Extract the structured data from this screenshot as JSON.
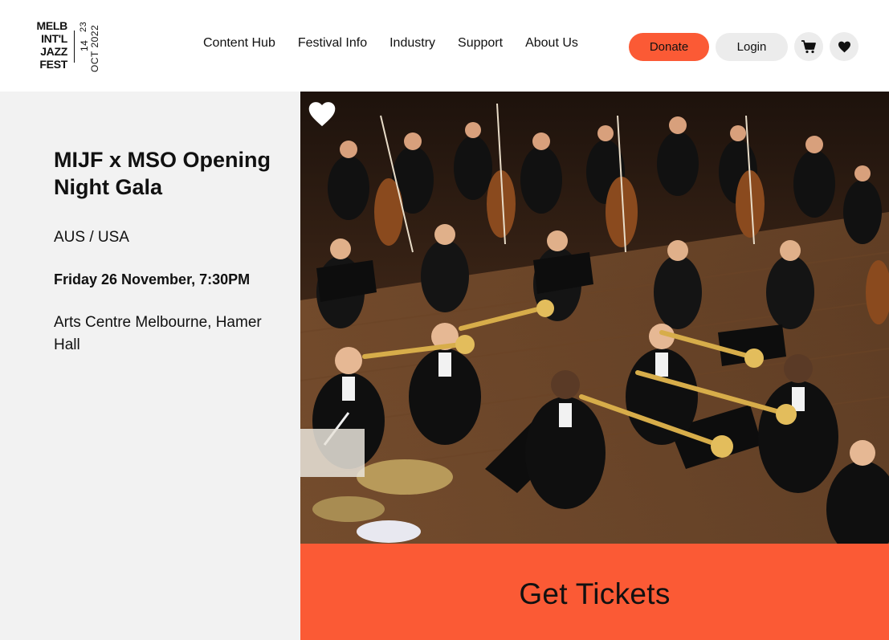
{
  "logo": {
    "words": [
      "MELB",
      "INT'L",
      "JAZZ",
      "FEST"
    ],
    "date_start": "14",
    "date_end": "23",
    "date_month_year": "OCT 2022"
  },
  "nav": {
    "items": [
      "Content Hub",
      "Festival Info",
      "Industry",
      "Support",
      "About Us"
    ]
  },
  "actions": {
    "donate_label": "Donate",
    "login_label": "Login",
    "cart_icon": "cart-icon",
    "favourites_icon": "heart-icon"
  },
  "event": {
    "title": "MIJF x MSO Opening Night Gala",
    "country": "AUS / USA",
    "date": "Friday 26 November, 7:30PM",
    "venue": "Arts Centre Melbourne, Hamer Hall"
  },
  "hero": {
    "favourite_icon": "heart-outline-icon"
  },
  "cta": {
    "label": "Get Tickets"
  },
  "colors": {
    "accent": "#fb5a35",
    "button_grey": "#ececec",
    "panel_grey": "#f2f2f2",
    "text": "#111111"
  }
}
